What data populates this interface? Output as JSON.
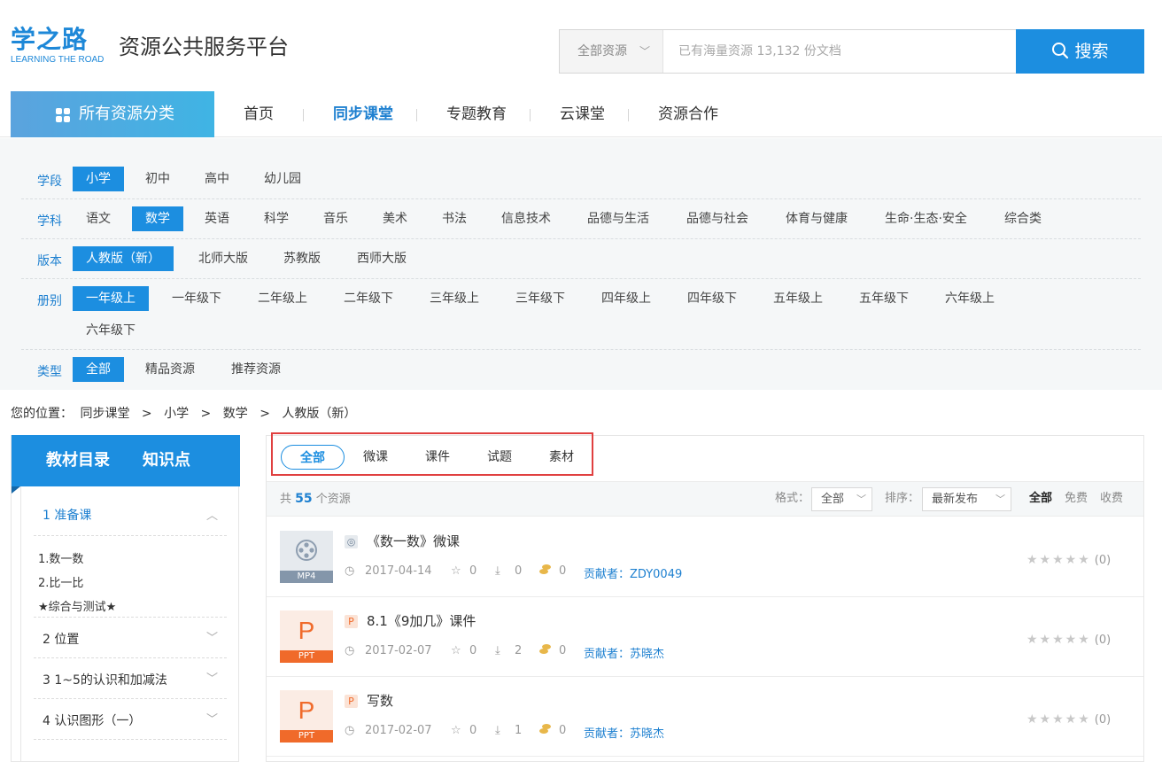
{
  "header": {
    "logo_main": "学之路",
    "logo_sub": "LEARNING THE ROAD",
    "site_title": "资源公共服务平台",
    "search": {
      "category": "全部资源",
      "placeholder": "已有海量资源 13,132 份文档",
      "button_label": "搜索"
    }
  },
  "nav": {
    "all_categories": "所有资源分类",
    "items": [
      "首页",
      "同步课堂",
      "专题教育",
      "云课堂",
      "资源合作"
    ],
    "active": "同步课堂"
  },
  "filters": {
    "stage": {
      "label": "学段",
      "options": [
        "小学",
        "初中",
        "高中",
        "幼儿园"
      ],
      "selected": "小学"
    },
    "subject": {
      "label": "学科",
      "options": [
        "语文",
        "数学",
        "英语",
        "科学",
        "音乐",
        "美术",
        "书法",
        "信息技术",
        "品德与生活",
        "品德与社会",
        "体育与健康",
        "生命·生态·安全",
        "综合类"
      ],
      "selected": "数学"
    },
    "edition": {
      "label": "版本",
      "options": [
        "人教版（新）",
        "北师大版",
        "苏教版",
        "西师大版"
      ],
      "selected": "人教版（新）"
    },
    "volume": {
      "label": "册别",
      "options": [
        "一年级上",
        "一年级下",
        "二年级上",
        "二年级下",
        "三年级上",
        "三年级下",
        "四年级上",
        "四年级下",
        "五年级上",
        "五年级下",
        "六年级上",
        "六年级下"
      ],
      "selected": "一年级上"
    },
    "type": {
      "label": "类型",
      "options": [
        "全部",
        "精品资源",
        "推荐资源"
      ],
      "selected": "全部"
    }
  },
  "breadcrumb": {
    "prefix": "您的位置：",
    "items": [
      "同步课堂",
      "小学",
      "数学",
      "人教版（新）"
    ],
    "separator": ">"
  },
  "sidebar": {
    "tabs": [
      "教材目录",
      "知识点"
    ],
    "chapters": [
      {
        "label": "1 准备课",
        "expanded": true,
        "children": [
          "1.数一数",
          "2.比一比",
          "★综合与测试★"
        ]
      },
      {
        "label": "2 位置",
        "expanded": false
      },
      {
        "label": "3 1~5的认识和加减法",
        "expanded": false
      },
      {
        "label": "4 认识图形（一）",
        "expanded": false
      }
    ]
  },
  "main": {
    "tabs": [
      "全部",
      "微课",
      "课件",
      "试题",
      "素材"
    ],
    "active_tab": "全部",
    "count_prefix": "共",
    "count": "55",
    "count_suffix": "个资源",
    "format_label": "格式：",
    "format_value": "全部",
    "sort_label": "排序：",
    "sort_value": "最新发布",
    "price_filters": [
      "全部",
      "免费",
      "收费"
    ],
    "price_active": "全部",
    "resources": [
      {
        "thumb_tag": "MP4",
        "kind": "video",
        "title": "《数一数》微课",
        "date": "2017-04-14",
        "favorites": "0",
        "downloads": "0",
        "coins": "0",
        "author": "贡献者：ZDY0049",
        "rating_count": "(0)"
      },
      {
        "thumb_tag": "PPT",
        "kind": "ppt",
        "title": "8.1《9加几》课件",
        "date": "2017-02-07",
        "favorites": "0",
        "downloads": "2",
        "coins": "0",
        "author": "贡献者：苏晓杰",
        "rating_count": "(0)"
      },
      {
        "thumb_tag": "PPT",
        "kind": "ppt",
        "title": "写数",
        "date": "2017-02-07",
        "favorites": "0",
        "downloads": "1",
        "coins": "0",
        "author": "贡献者：苏晓杰",
        "rating_count": "(0)"
      }
    ]
  },
  "colors": {
    "primary": "#1c8ee0",
    "highlight_border": "#e04040",
    "ppt_orange": "#f06a2a"
  }
}
